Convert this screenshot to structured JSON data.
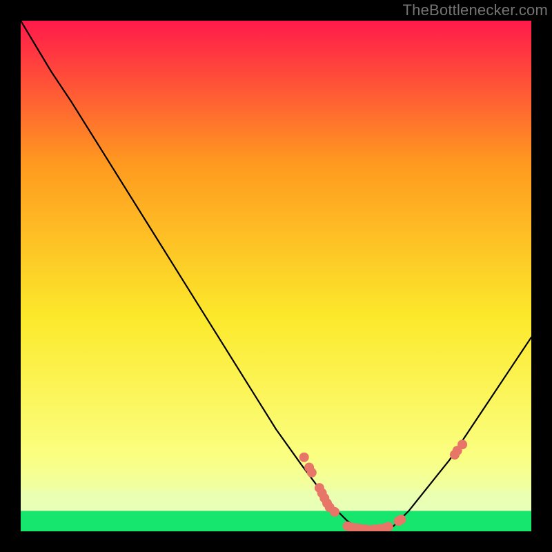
{
  "watermark": "TheBottlenecker.com",
  "chart_data": {
    "type": "line",
    "title": "",
    "xlabel": "",
    "ylabel": "",
    "xlim": [
      0,
      100
    ],
    "ylim": [
      0,
      100
    ],
    "grid": false,
    "background_gradient": {
      "top": "#FF1A4B",
      "mid_upper": "#FF9A1F",
      "mid": "#FCE92B",
      "mid_lower": "#FBFF80",
      "band": "#E8FFB8",
      "bottom": "#16E56E"
    },
    "green_band": {
      "y0": 0,
      "y1": 4
    },
    "pale_band": {
      "y0": 4,
      "y1": 8
    },
    "series": [
      {
        "name": "bottleneck-curve",
        "color": "#000000",
        "x": [
          0,
          3,
          6,
          10,
          15,
          20,
          25,
          30,
          35,
          40,
          45,
          50,
          55,
          58,
          61,
          64,
          67,
          70,
          73,
          76,
          80,
          84,
          88,
          92,
          96,
          100
        ],
        "y": [
          100,
          95,
          90,
          84,
          76,
          68,
          60,
          52,
          44,
          36,
          28,
          20,
          13,
          9,
          5,
          2,
          0,
          0,
          1,
          4,
          9,
          14,
          20,
          26,
          32,
          38
        ]
      }
    ],
    "markers": {
      "name": "highlighted-points",
      "color": "#E77568",
      "radius": 7,
      "points": [
        {
          "x": 55.5,
          "y": 14.5
        },
        {
          "x": 56.5,
          "y": 12.5
        },
        {
          "x": 57.0,
          "y": 11.5
        },
        {
          "x": 58.5,
          "y": 8.5
        },
        {
          "x": 59.0,
          "y": 7.5
        },
        {
          "x": 59.5,
          "y": 6.5
        },
        {
          "x": 60.0,
          "y": 5.5
        },
        {
          "x": 60.5,
          "y": 4.7
        },
        {
          "x": 61.5,
          "y": 3.8
        },
        {
          "x": 64.0,
          "y": 1.0
        },
        {
          "x": 64.8,
          "y": 0.8
        },
        {
          "x": 65.8,
          "y": 0.6
        },
        {
          "x": 66.5,
          "y": 0.5
        },
        {
          "x": 67.5,
          "y": 0.4
        },
        {
          "x": 68.5,
          "y": 0.3
        },
        {
          "x": 69.5,
          "y": 0.4
        },
        {
          "x": 70.5,
          "y": 0.5
        },
        {
          "x": 71.5,
          "y": 0.7
        },
        {
          "x": 72.0,
          "y": 0.9
        },
        {
          "x": 74.0,
          "y": 2.0
        },
        {
          "x": 74.5,
          "y": 2.3
        },
        {
          "x": 85.0,
          "y": 15.0
        },
        {
          "x": 85.5,
          "y": 15.8
        },
        {
          "x": 86.5,
          "y": 17.0
        }
      ]
    }
  }
}
